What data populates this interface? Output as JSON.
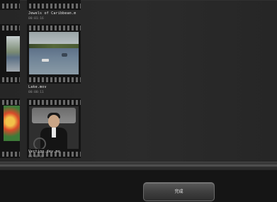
{
  "videos": [
    {
      "title": "Jewels of Caribbean.m",
      "duration": "00:01:16"
    },
    {
      "title": "Lake.mov",
      "duration": "00:00:11"
    },
    {
      "title": "Vertigo.dev.mo",
      "duration": "00:00:00"
    }
  ],
  "footer": {
    "done_label": "完成"
  },
  "colors": {
    "background": "#1f1f1f",
    "filmstrip": "#141414",
    "button": "#3f3f3f"
  }
}
